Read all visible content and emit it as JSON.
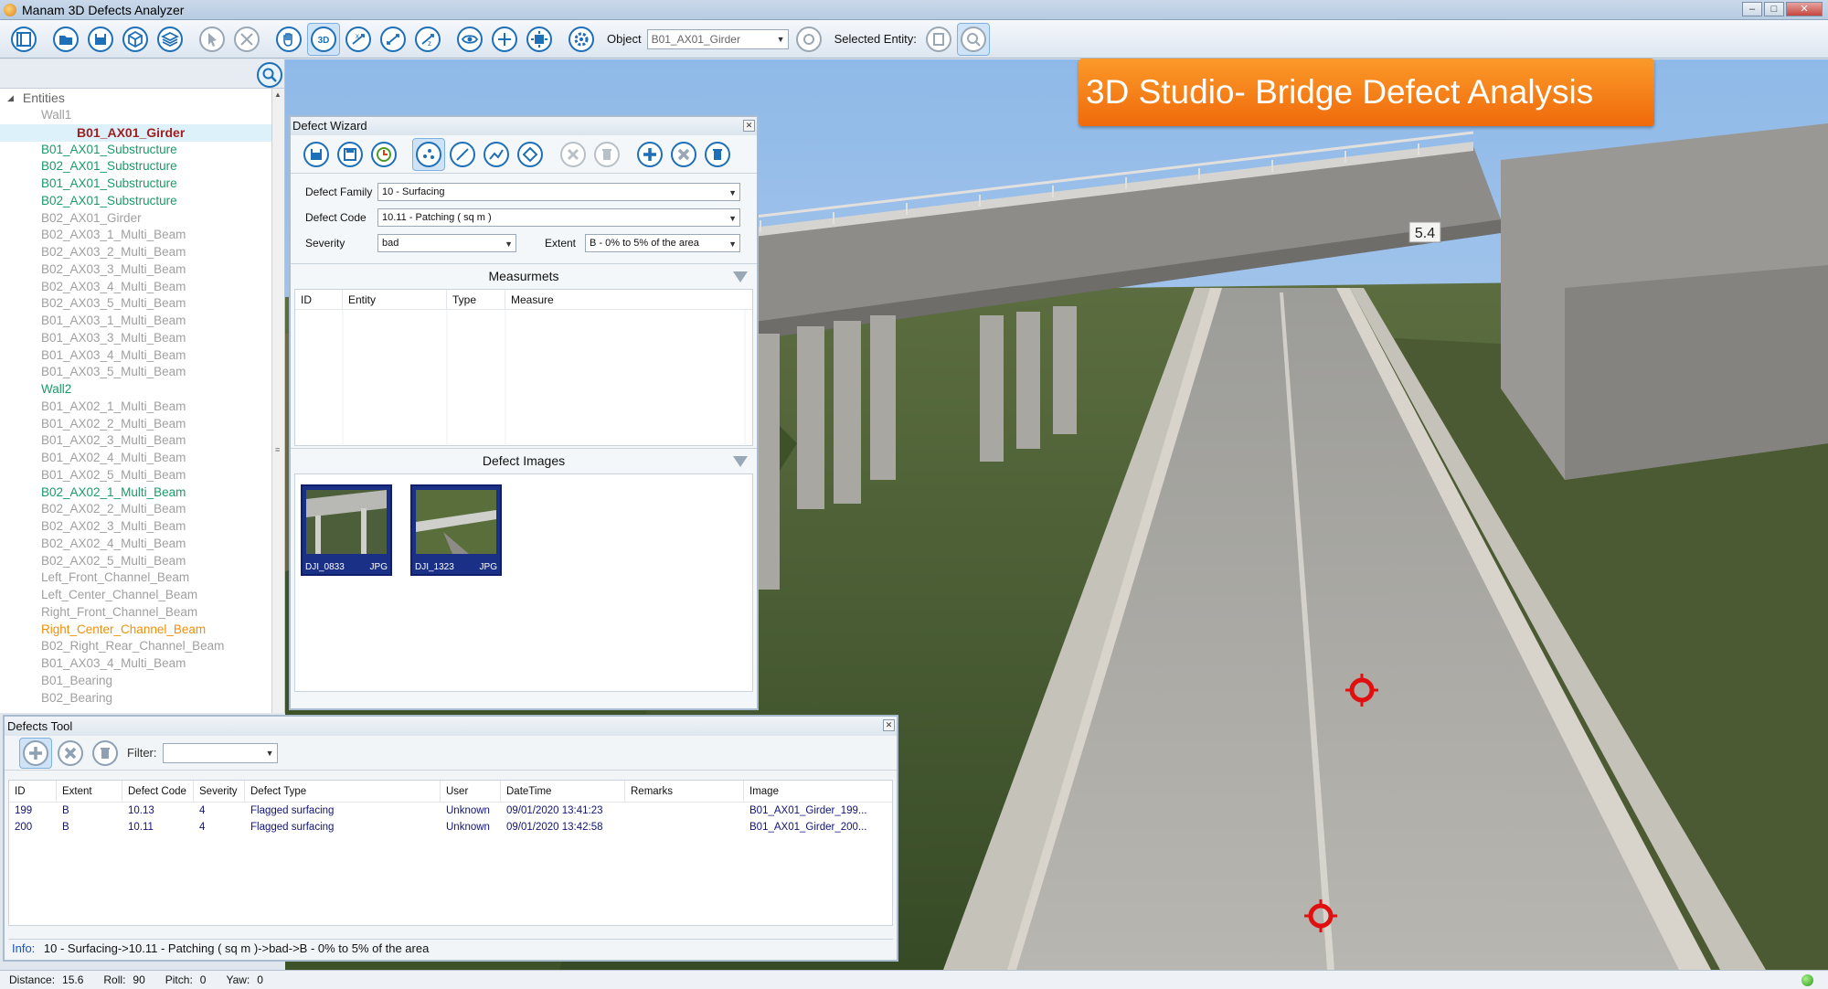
{
  "window": {
    "title": "Manam 3D Defects Analyzer"
  },
  "toolbar": {
    "object_label": "Object",
    "object_value": "B01_AX01_Girder",
    "selected_entity_label": "Selected Entity:"
  },
  "banner": {
    "text": "3D Studio- Bridge Defect Analysis"
  },
  "viewport": {
    "overpass_sign": "5.4"
  },
  "entities": {
    "root_label": "Entities",
    "items": [
      {
        "label": "Wall1",
        "style": "gray"
      },
      {
        "label": "B01_AX01_Girder",
        "style": "selected"
      },
      {
        "label": "B01_AX01_Substructure",
        "style": "green"
      },
      {
        "label": "B02_AX01_Substructure",
        "style": "green"
      },
      {
        "label": "B01_AX01_Substructure",
        "style": "green"
      },
      {
        "label": "B02_AX01_Substructure",
        "style": "green"
      },
      {
        "label": "B02_AX01_Girder",
        "style": "gray"
      },
      {
        "label": "B02_AX03_1_Multi_Beam",
        "style": "gray"
      },
      {
        "label": "B02_AX03_2_Multi_Beam",
        "style": "gray"
      },
      {
        "label": "B02_AX03_3_Multi_Beam",
        "style": "gray"
      },
      {
        "label": "B02_AX03_4_Multi_Beam",
        "style": "gray"
      },
      {
        "label": "B02_AX03_5_Multi_Beam",
        "style": "gray"
      },
      {
        "label": "B01_AX03_1_Multi_Beam",
        "style": "gray"
      },
      {
        "label": "B01_AX03_3_Multi_Beam",
        "style": "gray"
      },
      {
        "label": "B01_AX03_4_Multi_Beam",
        "style": "gray"
      },
      {
        "label": "B01_AX03_5_Multi_Beam",
        "style": "gray"
      },
      {
        "label": "Wall2",
        "style": "green"
      },
      {
        "label": "B01_AX02_1_Multi_Beam",
        "style": "gray"
      },
      {
        "label": "B01_AX02_2_Multi_Beam",
        "style": "gray"
      },
      {
        "label": "B01_AX02_3_Multi_Beam",
        "style": "gray"
      },
      {
        "label": "B01_AX02_4_Multi_Beam",
        "style": "gray"
      },
      {
        "label": "B01_AX02_5_Multi_Beam",
        "style": "gray"
      },
      {
        "label": "B02_AX02_1_Multi_Beam",
        "style": "green"
      },
      {
        "label": "B02_AX02_2_Multi_Beam",
        "style": "gray"
      },
      {
        "label": "B02_AX02_3_Multi_Beam",
        "style": "gray"
      },
      {
        "label": "B02_AX02_4_Multi_Beam",
        "style": "gray"
      },
      {
        "label": "B02_AX02_5_Multi_Beam",
        "style": "gray"
      },
      {
        "label": "Left_Front_Channel_Beam",
        "style": "gray"
      },
      {
        "label": "Left_Center_Channel_Beam",
        "style": "gray"
      },
      {
        "label": "Right_Front_Channel_Beam",
        "style": "gray"
      },
      {
        "label": "Right_Center_Channel_Beam",
        "style": "orange"
      },
      {
        "label": "B02_Right_Rear_Channel_Beam",
        "style": "gray"
      },
      {
        "label": "B01_AX03_4_Multi_Beam",
        "style": "gray"
      },
      {
        "label": "B01_Bearing",
        "style": "gray"
      },
      {
        "label": "B02_Bearing",
        "style": "gray"
      }
    ]
  },
  "wizard": {
    "title": "Defect Wizard",
    "defect_family_label": "Defect Family",
    "defect_family_value": "10 - Surfacing",
    "defect_code_label": "Defect Code",
    "defect_code_value": "10.11 - Patching ( sq m )",
    "severity_label": "Severity",
    "severity_value": "bad",
    "extent_label": "Extent",
    "extent_value": "B - 0% to 5% of the area",
    "measurements_header": "Measurmets",
    "measurements_columns": [
      "ID",
      "Entity",
      "Type",
      "Measure"
    ],
    "images_header": "Defect Images",
    "images": [
      {
        "name": "DJI_0833",
        "ext": "JPG"
      },
      {
        "name": "DJI_1323",
        "ext": "JPG"
      }
    ]
  },
  "defects_tool": {
    "title": "Defects Tool",
    "filter_label": "Filter:",
    "columns": [
      "ID",
      "Extent",
      "Defect Code",
      "Severity",
      "Defect Type",
      "User",
      "DateTime",
      "Remarks",
      "Image"
    ],
    "rows": [
      {
        "id": "199",
        "extent": "B",
        "code": "10.13",
        "severity": "4",
        "type": "Flagged surfacing",
        "user": "Unknown",
        "datetime": "09/01/2020 13:41:23",
        "remarks": "",
        "image": "B01_AX01_Girder_199..."
      },
      {
        "id": "200",
        "extent": "B",
        "code": "10.11",
        "severity": "4",
        "type": "Flagged surfacing",
        "user": "Unknown",
        "datetime": "09/01/2020 13:42:58",
        "remarks": "",
        "image": "B01_AX01_Girder_200..."
      }
    ],
    "info_label": "Info:",
    "info_text": "10 - Surfacing->10.11 - Patching ( sq m )->bad->B - 0% to 5% of the area"
  },
  "statusbar": {
    "distance_label": "Distance:",
    "distance_value": "15.6",
    "roll_label": "Roll:",
    "roll_value": "90",
    "pitch_label": "Pitch:",
    "pitch_value": "0",
    "yaw_label": "Yaw:",
    "yaw_value": "0"
  },
  "colors": {
    "accent_blue": "#1d6fb8",
    "selected_entity": "#a02020",
    "entity_green": "#1a9a6a",
    "entity_orange": "#f0900a",
    "banner_orange": "#f37a12",
    "defect_marker": "#e01010"
  }
}
